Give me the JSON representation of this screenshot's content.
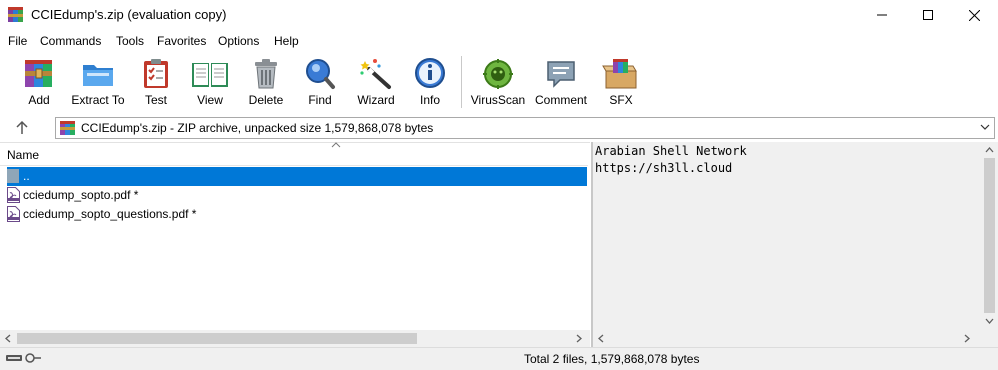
{
  "window": {
    "title": "CCIEdump's.zip (evaluation copy)",
    "icon": "winrar-icon",
    "controls": [
      "minimize-icon",
      "maximize-icon",
      "close-icon"
    ]
  },
  "menu": {
    "items": [
      "File",
      "Commands",
      "Tools",
      "Favorites",
      "Options",
      "Help"
    ]
  },
  "toolbar": {
    "buttons": [
      {
        "label": "Add",
        "icon": "add-archive-icon"
      },
      {
        "label": "Extract To",
        "icon": "extract-folder-icon"
      },
      {
        "label": "Test",
        "icon": "test-clipboard-icon"
      },
      {
        "label": "View",
        "icon": "view-book-icon"
      },
      {
        "label": "Delete",
        "icon": "trash-icon"
      },
      {
        "label": "Find",
        "icon": "magnifier-icon"
      },
      {
        "label": "Wizard",
        "icon": "wizard-wand-icon"
      },
      {
        "label": "Info",
        "icon": "info-icon"
      },
      {
        "label": "VirusScan",
        "icon": "virus-scan-icon"
      },
      {
        "label": "Comment",
        "icon": "comment-icon"
      },
      {
        "label": "SFX",
        "icon": "sfx-box-icon"
      }
    ]
  },
  "address": {
    "text": "CCIEdump's.zip - ZIP archive, unpacked size 1,579,868,078 bytes"
  },
  "file_list": {
    "column_header": "Name",
    "rows": [
      {
        "name": "..",
        "type": "parent",
        "selected": true
      },
      {
        "name": "cciedump_sopto.pdf *",
        "type": "pdf"
      },
      {
        "name": "cciedump_sopto_questions.pdf *",
        "type": "pdf"
      }
    ]
  },
  "comment": {
    "lines": [
      "Arabian Shell Network",
      "https://sh3ll.cloud"
    ]
  },
  "status": {
    "text": "Total 2 files, 1,579,868,078 bytes"
  },
  "colors": {
    "selection": "#0078d7",
    "pane_background": "#f0f0f0"
  }
}
